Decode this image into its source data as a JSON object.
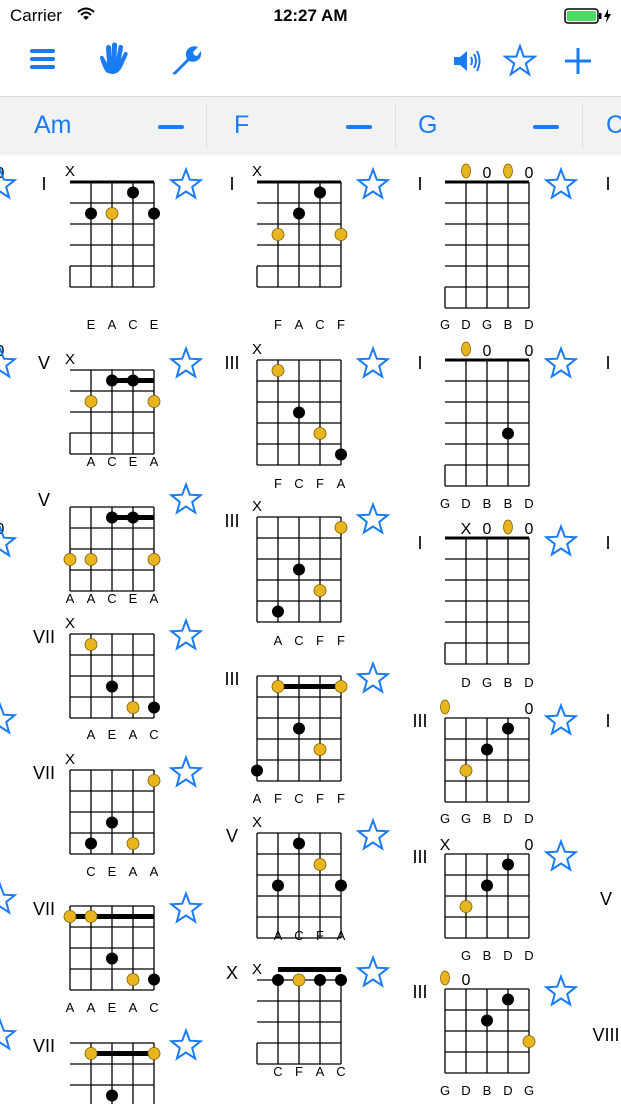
{
  "status": {
    "carrier": "Carrier",
    "time": "12:27 AM"
  },
  "toolbar": {
    "left_icons": [
      "menu-icon",
      "hand-icon",
      "wrench-icon"
    ],
    "right_icons": [
      "speaker-icon",
      "star-icon",
      "plus-icon"
    ]
  },
  "chords": [
    {
      "name": "Am",
      "remove_icon": "minus-icon"
    },
    {
      "name": "F",
      "remove_icon": "minus-icon"
    },
    {
      "name": "G",
      "remove_icon": "minus-icon"
    },
    {
      "name": "C",
      "remove_icon": "minus-icon"
    }
  ],
  "colors": {
    "accent": "#1a7cf4",
    "root_dot": "#e8b51e",
    "dot": "#000000",
    "chordbar_bg": "#f2f2f2"
  },
  "voicings": {
    "col0": [
      {
        "position": "I",
        "mute": "X",
        "strings": [
          "E",
          "A",
          "C",
          "E"
        ],
        "favorite": "star-icon"
      },
      {
        "position": "V",
        "mute": "X",
        "strings": [
          "A",
          "C",
          "E",
          "A"
        ],
        "favorite": "star-icon"
      },
      {
        "position": "V",
        "mute": "",
        "strings": [
          "A",
          "A",
          "C",
          "E",
          "A"
        ],
        "favorite": "star-icon"
      },
      {
        "position": "VII",
        "mute": "X",
        "strings": [
          "A",
          "E",
          "A",
          "C"
        ],
        "favorite": "star-icon"
      },
      {
        "position": "VII",
        "mute": "X",
        "strings": [
          "C",
          "E",
          "A",
          "A"
        ],
        "favorite": "star-icon"
      },
      {
        "position": "VII",
        "mute": "",
        "strings": [
          "A",
          "A",
          "E",
          "A",
          "C"
        ],
        "favorite": "star-icon"
      },
      {
        "position": "VII",
        "mute": "",
        "strings": [],
        "favorite": "star-icon"
      }
    ],
    "col1": [
      {
        "position": "I",
        "mute": "X",
        "strings": [
          "F",
          "A",
          "C",
          "F"
        ],
        "favorite": "star-icon"
      },
      {
        "position": "III",
        "mute": "X",
        "strings": [
          "F",
          "C",
          "F",
          "A"
        ],
        "favorite": "star-icon"
      },
      {
        "position": "III",
        "mute": "X",
        "strings": [
          "A",
          "C",
          "F",
          "F"
        ],
        "favorite": "star-icon"
      },
      {
        "position": "III",
        "mute": "",
        "strings": [
          "A",
          "F",
          "C",
          "F",
          "F"
        ],
        "favorite": "star-icon"
      },
      {
        "position": "V",
        "mute": "X",
        "strings": [
          "A",
          "C",
          "F",
          "A"
        ],
        "favorite": "star-icon"
      },
      {
        "position": "X",
        "mute": "X",
        "strings": [
          "C",
          "F",
          "A",
          "C"
        ],
        "favorite": "star-icon"
      }
    ],
    "col2": [
      {
        "position": "I",
        "open": [
          "0",
          "0",
          "0"
        ],
        "strings": [
          "G",
          "D",
          "G",
          "B",
          "D"
        ],
        "favorite": "star-icon"
      },
      {
        "position": "I",
        "open": [
          "0",
          "0",
          "0"
        ],
        "strings": [
          "G",
          "D",
          "B",
          "B",
          "D"
        ],
        "favorite": "star-icon"
      },
      {
        "position": "I",
        "open": [
          "X",
          "0",
          "0",
          "0"
        ],
        "strings": [
          "D",
          "G",
          "B",
          "D"
        ],
        "favorite": "star-icon"
      },
      {
        "position": "III",
        "open": [
          "0"
        ],
        "strings": [
          "G",
          "G",
          "B",
          "D",
          "D"
        ],
        "favorite": "star-icon"
      },
      {
        "position": "III",
        "open": [
          "X",
          "0"
        ],
        "strings": [
          "G",
          "B",
          "D",
          "D"
        ],
        "favorite": "star-icon"
      },
      {
        "position": "III",
        "open": [
          "0"
        ],
        "strings": [
          "G",
          "D",
          "B",
          "D",
          "G"
        ],
        "favorite": "star-icon"
      }
    ],
    "col3": [
      {
        "position": "I"
      },
      {
        "position": "I"
      },
      {
        "position": "I"
      },
      {
        "position": "I"
      },
      {
        "position": "V"
      },
      {
        "position": "VIII"
      }
    ]
  }
}
